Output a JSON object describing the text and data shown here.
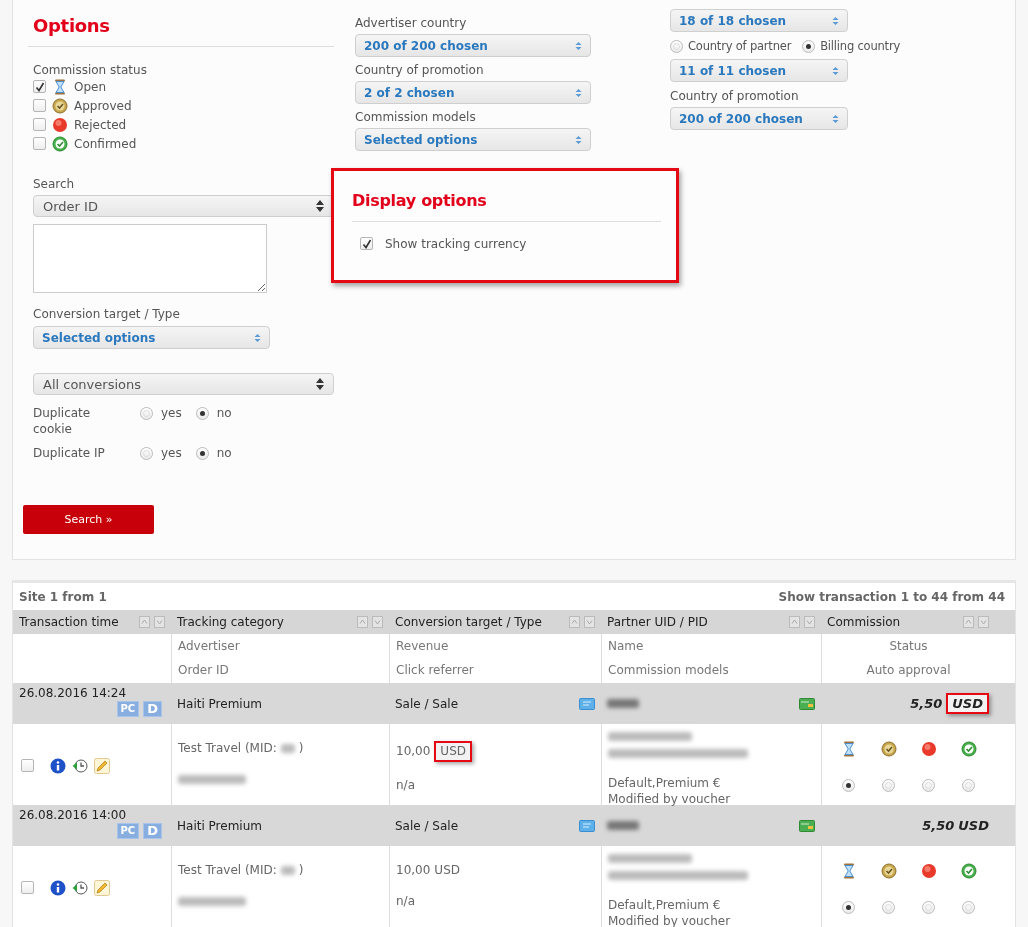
{
  "filters": {
    "title": "Options",
    "commission_status": {
      "label": "Commission status",
      "items": [
        {
          "kind": "open",
          "label": "Open",
          "checked": true
        },
        {
          "kind": "approved",
          "label": "Approved",
          "checked": false
        },
        {
          "kind": "rejected",
          "label": "Rejected",
          "checked": false
        },
        {
          "kind": "confirmed",
          "label": "Confirmed",
          "checked": false
        }
      ]
    },
    "search": {
      "label": "Search",
      "field": "Order ID"
    },
    "conversion_target": {
      "label": "Conversion target / Type",
      "value": "Selected options"
    },
    "conversions": "All conversions",
    "duplicates": [
      {
        "label": "Duplicate cookie",
        "options": [
          {
            "label": "yes",
            "selected": false
          },
          {
            "label": "no",
            "selected": true
          }
        ]
      },
      {
        "label": "Duplicate IP",
        "options": [
          {
            "label": "yes",
            "selected": false
          },
          {
            "label": "no",
            "selected": true
          }
        ]
      }
    ],
    "search_button": "Search »",
    "middle": [
      {
        "label": "Advertiser country",
        "value": "200 of 200 chosen"
      },
      {
        "label": "Country of promotion",
        "value": "2 of 2 chosen"
      },
      {
        "label": "Commission models",
        "value": "Selected options"
      }
    ],
    "right": [
      {
        "kind": "select",
        "value": "18 of 18 chosen"
      },
      {
        "kind": "radios",
        "options": [
          {
            "label": "Country of partner",
            "selected": false
          },
          {
            "label": "Billing country",
            "selected": true
          }
        ]
      },
      {
        "kind": "select",
        "value": "11 of 11 chosen"
      },
      {
        "kind": "select",
        "label": "Country of promotion",
        "value": "200 of 200 chosen"
      }
    ]
  },
  "display_options": {
    "title": "Display options",
    "highlighted": true,
    "items": [
      {
        "label": "Show tracking currency",
        "checked": true
      }
    ]
  },
  "transactions": {
    "pager": "Site 1 from 1",
    "summary": "Show transaction 1 to 44 from 44",
    "columns": [
      {
        "title": "Transaction time"
      },
      {
        "title": "Tracking category",
        "subtitles": [
          "Advertiser",
          "Order ID"
        ]
      },
      {
        "title": "Conversion target / Type",
        "subtitles": [
          "Revenue",
          "Click referrer"
        ]
      },
      {
        "title": "Partner UID / PID",
        "subtitles": [
          "Name",
          "Commission models"
        ]
      },
      {
        "title": "Commission",
        "subtitles": [
          "Status",
          "Auto approval"
        ]
      }
    ],
    "rows": [
      {
        "time": "26.08.2016 14:24",
        "badges": [
          "PC",
          "D"
        ],
        "category": "Haiti Premium",
        "conversion": "Sale / Sale",
        "commission": "5,50",
        "commission_currency": "USD",
        "commission_currency_highlighted": true,
        "checked": false,
        "advertiser_prefix": "Test Travel (MID:",
        "advertiser_suffix": ")",
        "revenue": "10,00",
        "revenue_currency": "USD",
        "revenue_currency_highlighted": true,
        "click_referrer": "n/a",
        "commission_models": "Default,Premium €",
        "note": "Modified by voucher",
        "statuses": [
          {
            "kind": "open",
            "selected": true
          },
          {
            "kind": "approved",
            "selected": false
          },
          {
            "kind": "rejected",
            "selected": false
          },
          {
            "kind": "confirmed",
            "selected": false
          }
        ]
      },
      {
        "time": "26.08.2016 14:00",
        "badges": [
          "PC",
          "D"
        ],
        "category": "Haiti Premium",
        "conversion": "Sale / Sale",
        "commission": "5,50",
        "commission_currency": "USD",
        "commission_currency_highlighted": false,
        "checked": false,
        "advertiser_prefix": "Test Travel (MID:",
        "advertiser_suffix": ")",
        "revenue": "10,00",
        "revenue_currency": "USD",
        "revenue_currency_highlighted": false,
        "click_referrer": "n/a",
        "commission_models": "Default,Premium €",
        "note": "Modified by voucher",
        "statuses": [
          {
            "kind": "open",
            "selected": true
          },
          {
            "kind": "approved",
            "selected": false
          },
          {
            "kind": "rejected",
            "selected": false
          },
          {
            "kind": "confirmed",
            "selected": false
          }
        ]
      }
    ]
  }
}
